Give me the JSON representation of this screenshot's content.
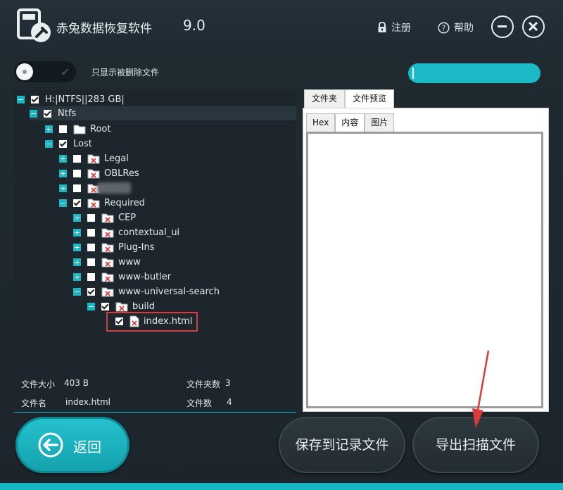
{
  "app": {
    "title": "赤兔数据恢复软件",
    "version": "9.0"
  },
  "header": {
    "register_label": "注册",
    "help_label": "帮助"
  },
  "filter": {
    "toggle_label": "只显示被删除文件",
    "search_value": ""
  },
  "tree": [
    {
      "label": "H:|NTFS||283 GB|",
      "expander": "minus",
      "checked": true,
      "icon": "none"
    },
    {
      "label": "Ntfs",
      "expander": "minus",
      "checked": true,
      "icon": "none"
    },
    {
      "label": "Root",
      "expander": "plus",
      "checked": false,
      "icon": "folder-icon"
    },
    {
      "label": "Lost",
      "expander": "minus",
      "checked": true,
      "icon": "none"
    },
    {
      "label": "Legal",
      "expander": "plus",
      "checked": false,
      "icon": "deleted-folder-icon"
    },
    {
      "label": "OBLRes",
      "expander": "plus",
      "checked": false,
      "icon": "deleted-folder-icon"
    },
    {
      "label": "",
      "expander": "plus",
      "checked": false,
      "icon": "deleted-folder-icon"
    },
    {
      "label": "Required",
      "expander": "minus",
      "checked": true,
      "icon": "deleted-folder-icon"
    },
    {
      "label": "CEP",
      "expander": "plus",
      "checked": false,
      "icon": "deleted-folder-icon"
    },
    {
      "label": "contextual_ui",
      "expander": "plus",
      "checked": false,
      "icon": "deleted-folder-icon"
    },
    {
      "label": "Plug-Ins",
      "expander": "plus",
      "checked": false,
      "icon": "deleted-folder-icon"
    },
    {
      "label": "www",
      "expander": "plus",
      "checked": false,
      "icon": "deleted-folder-icon"
    },
    {
      "label": "www-butler",
      "expander": "plus",
      "checked": false,
      "icon": "deleted-folder-icon"
    },
    {
      "label": "www-universal-search",
      "expander": "minus",
      "checked": true,
      "icon": "deleted-folder-icon"
    },
    {
      "label": "build",
      "expander": "minus",
      "checked": true,
      "icon": "deleted-folder-icon"
    },
    {
      "label": "index.html",
      "expander": "none",
      "checked": true,
      "icon": "deleted-file-icon"
    }
  ],
  "stats": {
    "file_size_label": "文件大小",
    "file_size_value": "403 B",
    "folder_count_label": "文件夹数",
    "folder_count_value": "3",
    "file_name_label": "文件名",
    "file_name_value": "index.html",
    "file_count_label": "文件数",
    "file_count_value": "4"
  },
  "preview": {
    "tabs": [
      "文件夹",
      "文件预览"
    ],
    "active_tab": "文件预览",
    "subtabs": [
      "Hex",
      "内容",
      "图片"
    ],
    "active_subtab": "内容"
  },
  "buttons": {
    "back_label": "返回",
    "save_label": "保存到记录文件",
    "export_label": "导出扫描文件"
  },
  "colors": {
    "accent": "#19b6c4",
    "background": "#1f2a31",
    "panel": "#1d262c",
    "highlight": "#d93a3a"
  }
}
